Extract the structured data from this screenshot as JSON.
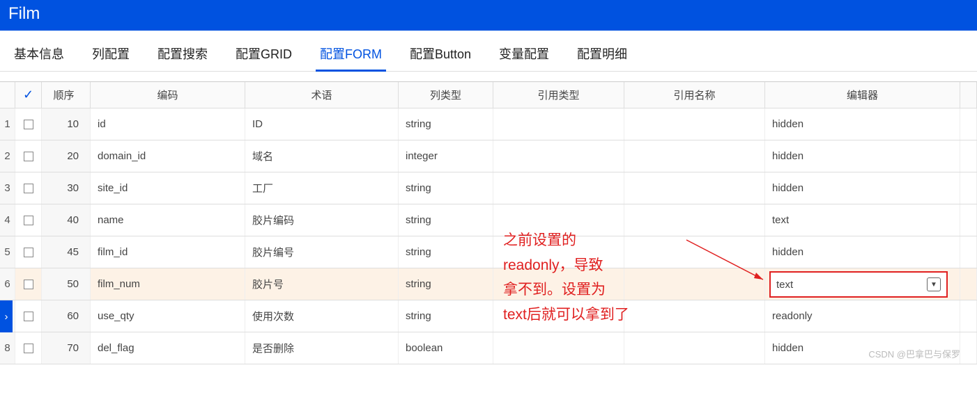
{
  "header": {
    "title": "Film"
  },
  "tabs": [
    {
      "label": "基本信息",
      "active": false
    },
    {
      "label": "列配置",
      "active": false
    },
    {
      "label": "配置搜索",
      "active": false
    },
    {
      "label": "配置GRID",
      "active": false
    },
    {
      "label": "配置FORM",
      "active": true
    },
    {
      "label": "配置Button",
      "active": false
    },
    {
      "label": "变量配置",
      "active": false
    },
    {
      "label": "配置明细",
      "active": false
    }
  ],
  "columns": {
    "seq": "顺序",
    "code": "编码",
    "term": "术语",
    "type": "列类型",
    "reftype": "引用类型",
    "refname": "引用名称",
    "editor": "编辑器"
  },
  "rows": [
    {
      "idx": "1",
      "seq": "10",
      "code": "id",
      "term": "ID",
      "type": "string",
      "reftype": "",
      "refname": "",
      "editor": "hidden"
    },
    {
      "idx": "2",
      "seq": "20",
      "code": "domain_id",
      "term": "域名",
      "type": "integer",
      "reftype": "",
      "refname": "",
      "editor": "hidden"
    },
    {
      "idx": "3",
      "seq": "30",
      "code": "site_id",
      "term": "工厂",
      "type": "string",
      "reftype": "",
      "refname": "",
      "editor": "hidden"
    },
    {
      "idx": "4",
      "seq": "40",
      "code": "name",
      "term": "胶片编码",
      "type": "string",
      "reftype": "",
      "refname": "",
      "editor": "text"
    },
    {
      "idx": "5",
      "seq": "45",
      "code": "film_id",
      "term": "胶片编号",
      "type": "string",
      "reftype": "",
      "refname": "",
      "editor": "hidden"
    },
    {
      "idx": "6",
      "seq": "50",
      "code": "film_num",
      "term": "胶片号",
      "type": "string",
      "reftype": "",
      "refname": "",
      "editor": "text",
      "selected": true
    },
    {
      "idx": "",
      "seq": "60",
      "code": "use_qty",
      "term": "使用次数",
      "type": "string",
      "reftype": "",
      "refname": "",
      "editor": "readonly",
      "indicator": true
    },
    {
      "idx": "8",
      "seq": "70",
      "code": "del_flag",
      "term": "是否删除",
      "type": "boolean",
      "reftype": "",
      "refname": "",
      "editor": "hidden"
    }
  ],
  "annotation": {
    "text": "之前设置的readonly，导致拿不到。设置为text后就可以拿到了"
  },
  "watermark": "CSDN @巴拿巴与保罗"
}
